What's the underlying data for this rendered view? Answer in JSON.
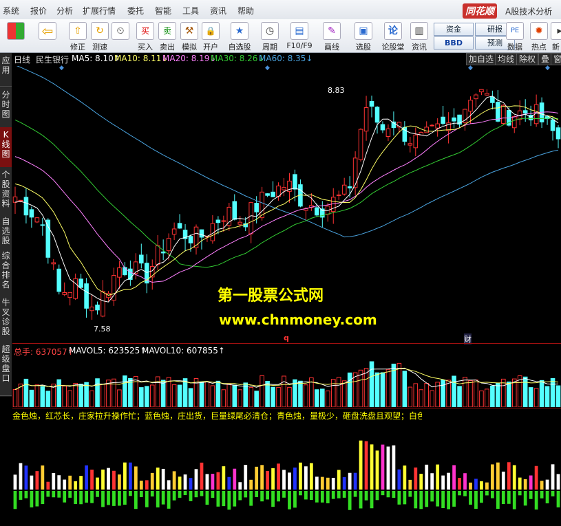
{
  "menubar": {
    "items": [
      "系统",
      "报价",
      "分析",
      "扩展行情",
      "委托",
      "智能",
      "工具",
      "资讯",
      "帮助"
    ],
    "brand": "同花顺",
    "brand_sub": "A股技术分析"
  },
  "toolbar": {
    "items": [
      {
        "label": "",
        "icon": "windows-icon",
        "glyph": "▦"
      },
      {
        "label": "",
        "icon": "back-arrow-icon",
        "glyph": "⇦"
      },
      {
        "label": "修正",
        "icon": "up-arrow-icon",
        "glyph": "⇧"
      },
      {
        "label": "测速",
        "icon": "refresh-icon",
        "glyph": "↻"
      },
      {
        "label": "",
        "icon": "clock-icon",
        "glyph": "⏲"
      },
      {
        "label": "买入",
        "icon": "buy-icon",
        "glyph": "买"
      },
      {
        "label": "卖出",
        "icon": "sell-icon",
        "glyph": "卖"
      },
      {
        "label": "模拟",
        "icon": "hammer-icon",
        "glyph": "⚒"
      },
      {
        "label": "开户",
        "icon": "lock-icon",
        "glyph": "🔒"
      },
      {
        "label": "自选股",
        "icon": "star-icon",
        "glyph": "★"
      },
      {
        "label": "周期",
        "icon": "cycle-icon",
        "glyph": "◷"
      },
      {
        "label": "F10/F9",
        "icon": "f10-icon",
        "glyph": "▤"
      },
      {
        "label": "画线",
        "icon": "pen-icon",
        "glyph": "✎"
      },
      {
        "label": "选股",
        "icon": "screen-icon",
        "glyph": "▣"
      },
      {
        "label": "论股堂",
        "icon": "forum-icon",
        "glyph": "论"
      },
      {
        "label": "资讯",
        "icon": "doc-icon",
        "glyph": "▥"
      },
      {
        "label": "数据",
        "icon": "pe-icon",
        "glyph": "PE"
      },
      {
        "label": "热点",
        "icon": "hot-icon",
        "glyph": "✹"
      },
      {
        "label": "新",
        "icon": "new-icon",
        "glyph": "▸"
      }
    ],
    "pills": [
      "资金",
      "研报",
      "BBD",
      "预测"
    ]
  },
  "sidebar": {
    "tabs": [
      "应用",
      "分时图",
      "K线图",
      "个股资料",
      "自选股",
      "综合排名",
      "牛叉诊股",
      "超级盘口"
    ],
    "active": "K线图"
  },
  "chart_header": {
    "period": "日线",
    "stock": "民生银行",
    "ma5": "MA5: 8.10↑",
    "ma10": "MA10: 8.11↓",
    "ma20": "MA20: 8.19↓",
    "ma30": "MA30: 8.26↓",
    "ma60": "MA60: 8.35↓",
    "buttons": [
      "加自选",
      "均线",
      "除权",
      "叠",
      "窗"
    ]
  },
  "price_panel": {
    "high_label": "8.83",
    "low_label": "7.58",
    "marker_q": "q",
    "marker_cai": "财",
    "watermark_cn": "第一股票公式网",
    "watermark_url": "www.chnmoney.com"
  },
  "volume_panel": {
    "total": "总手: 637057↑",
    "mavol5": "MAVOL5: 623525↑",
    "mavol10": "MAVOL10: 607855↑"
  },
  "indicator_panel": {
    "caption": "金色烛，红芯长，庄家拉升操作忙；蓝色烛，庄出货，巨量绿尾必清仓；青色烛，量极少，砸盘洗盘且观望；白色"
  },
  "colors": {
    "ma5": "#ffffff",
    "ma10": "#ffff66",
    "ma20": "#ff80ff",
    "ma30": "#33cc33",
    "ma60": "#4aa3df",
    "up": "#ff3333",
    "down": "#54ffff",
    "label": "#ffff00"
  }
}
